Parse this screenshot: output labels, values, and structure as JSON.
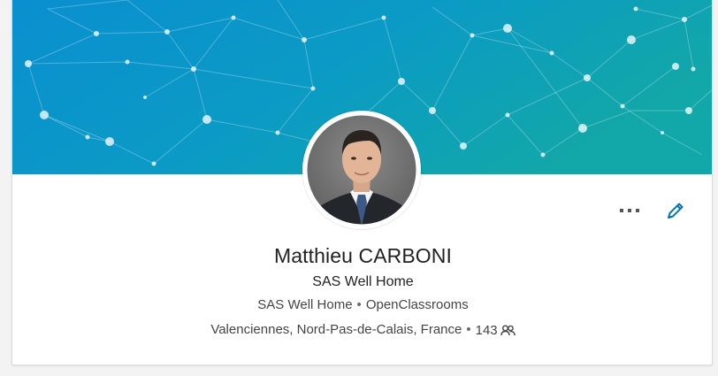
{
  "profile": {
    "name": "Matthieu CARBONI",
    "headline": "SAS Well Home",
    "positions": {
      "company": "SAS Well Home",
      "separator": "•",
      "school": "OpenClassrooms"
    },
    "location": {
      "place": "Valenciennes, Nord-Pas-de-Calais, France",
      "separator": "•",
      "connections": "143"
    }
  },
  "icons": {
    "more": "more-horizontal-icon",
    "edit": "pencil-icon",
    "connections": "people-icon"
  },
  "colors": {
    "banner_start": "#0a8fd0",
    "banner_end": "#0fa3a9",
    "accent": "#0073b1",
    "text": "#222222"
  }
}
